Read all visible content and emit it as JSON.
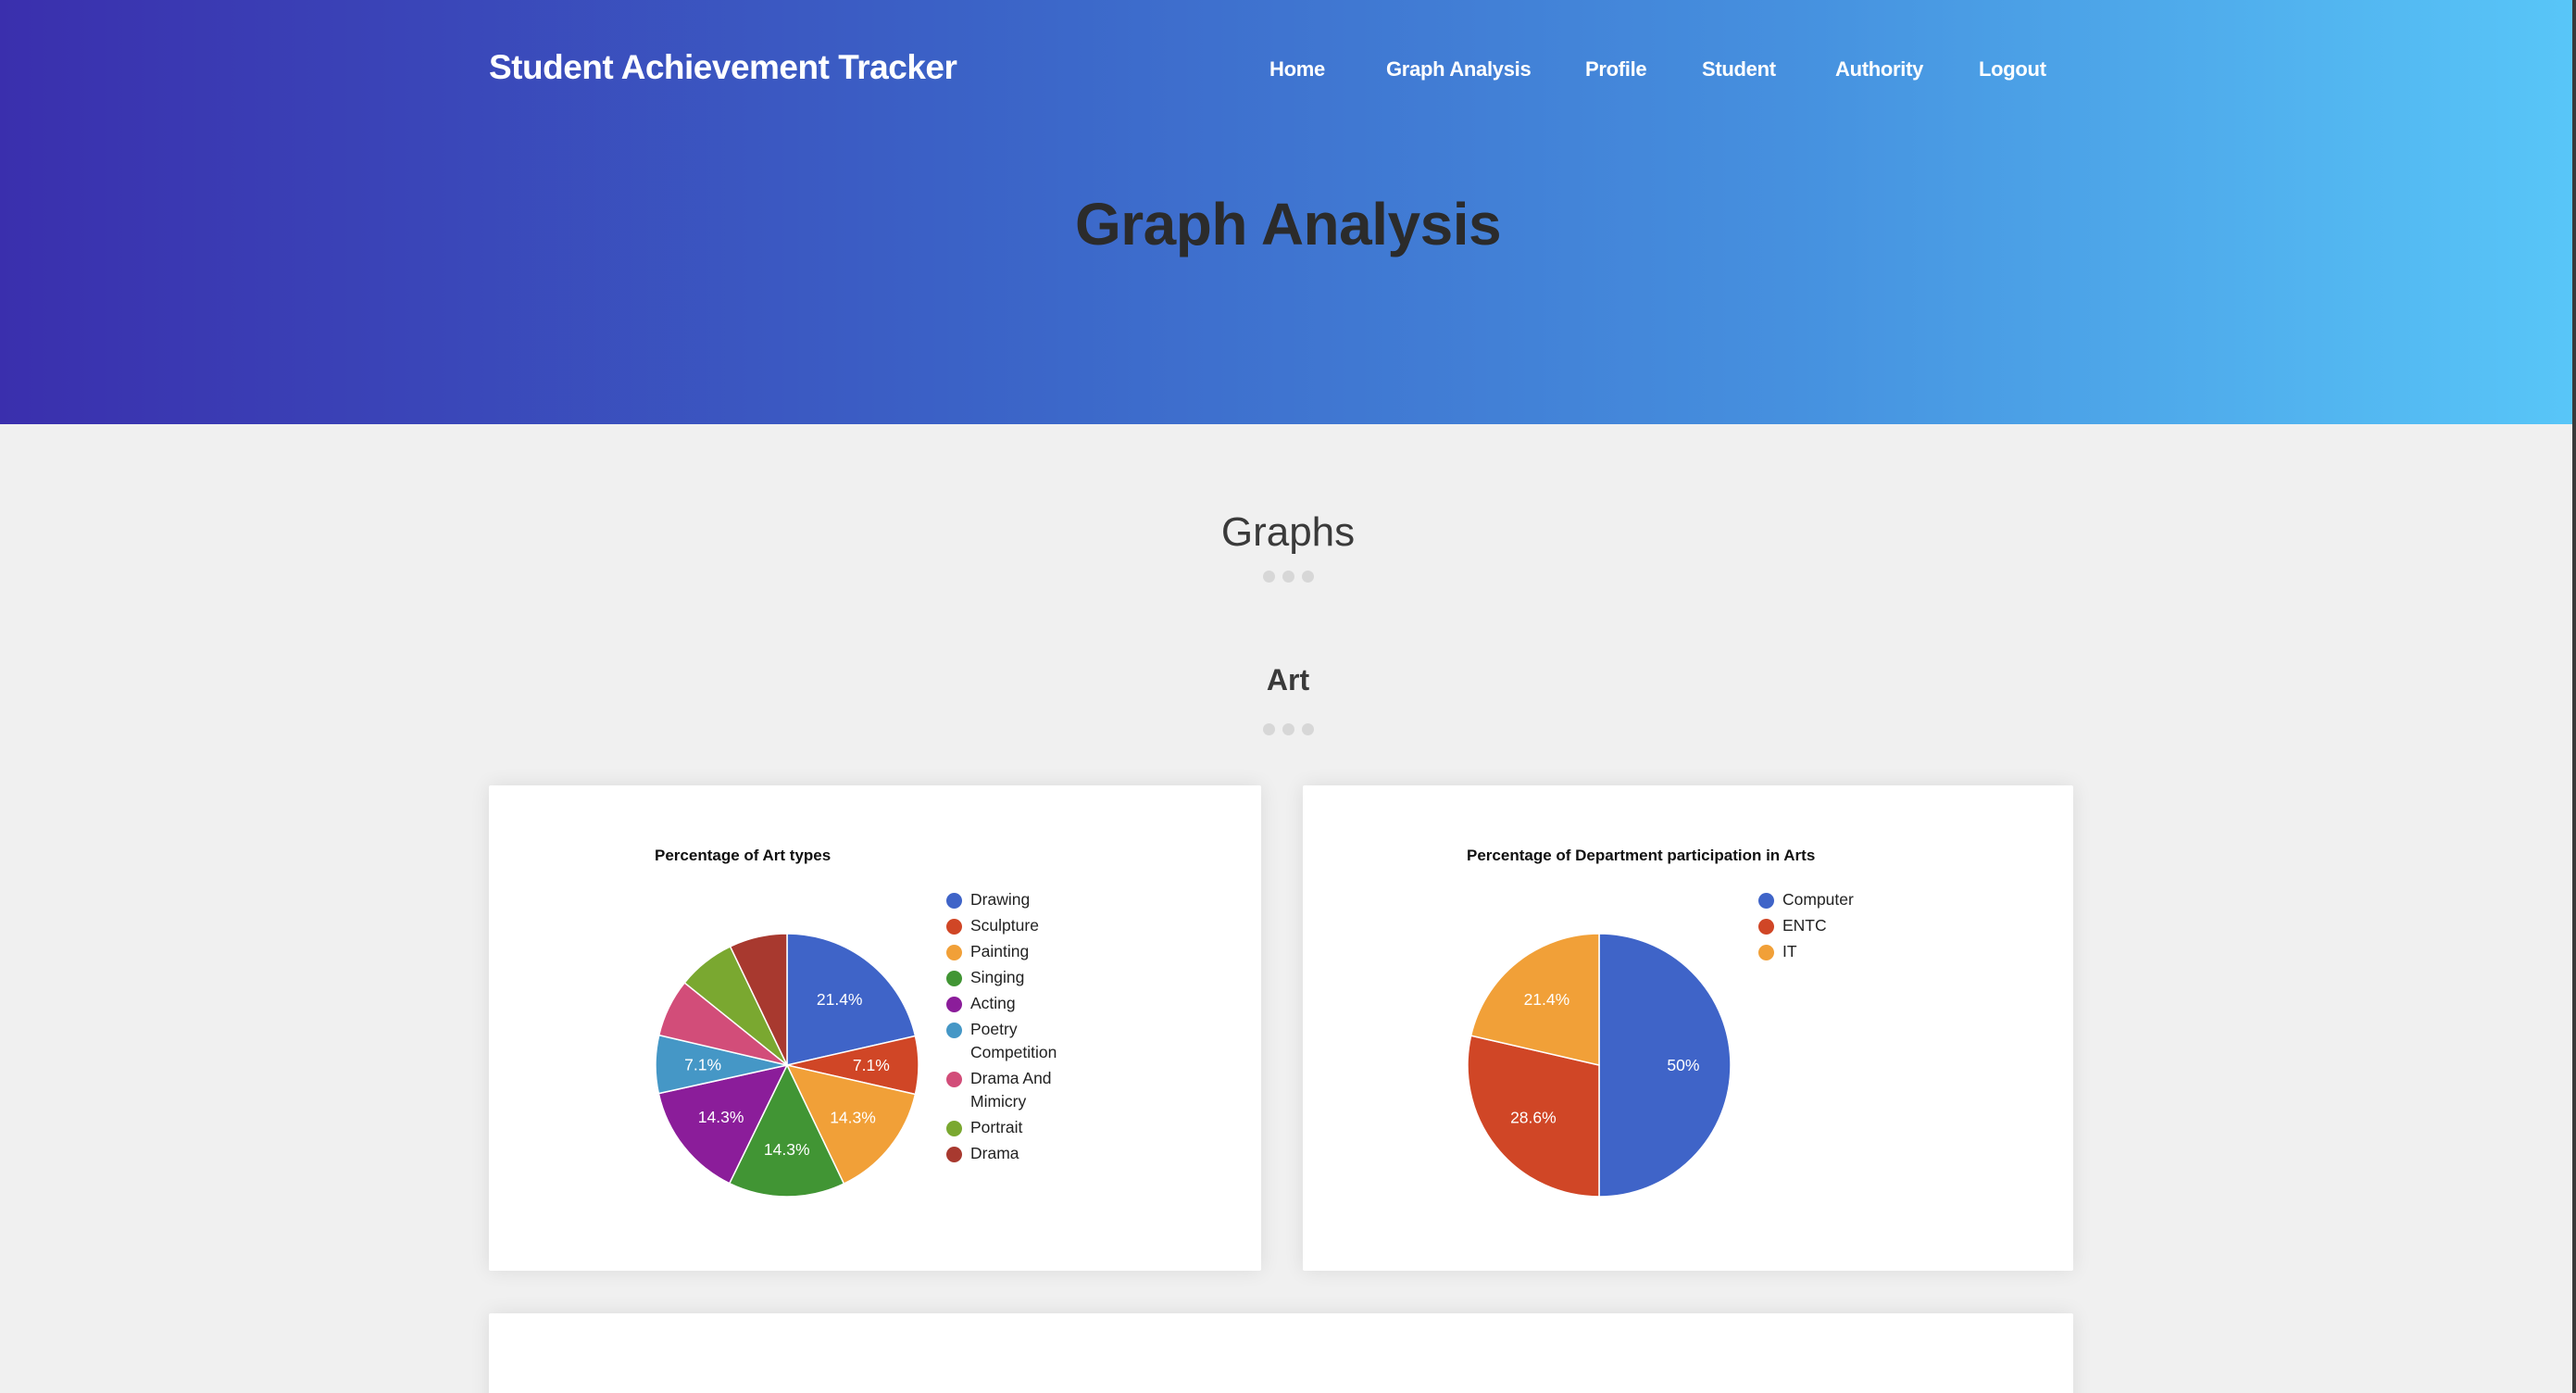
{
  "header": {
    "brand": "Student Achievement Tracker",
    "nav": [
      {
        "label": "Home"
      },
      {
        "label": "Graph Analysis"
      },
      {
        "label": "Profile"
      },
      {
        "label": "Student"
      },
      {
        "label": "Authority"
      },
      {
        "label": "Logout"
      }
    ],
    "page_title": "Graph Analysis"
  },
  "main": {
    "section_title": "Graphs",
    "subsection_title": "Art"
  },
  "chart_data": [
    {
      "type": "pie",
      "title": "Percentage of Art types",
      "categories": [
        "Drawing",
        "Sculpture",
        "Painting",
        "Singing",
        "Acting",
        "Poetry Competition",
        "Drama And Mimicry",
        "Portrait",
        "Drama"
      ],
      "values": [
        21.4,
        7.1,
        14.3,
        14.3,
        14.3,
        7.1,
        7.1,
        7.1,
        7.1
      ],
      "data_labels": [
        "21.4%",
        "7.1%",
        "14.3%",
        "14.3%",
        "14.3%",
        "7.1%",
        "",
        "",
        ""
      ],
      "colors": [
        "#3f64c8",
        "#d04626",
        "#f1a038",
        "#419534",
        "#8b1d9a",
        "#4597c6",
        "#d24d79",
        "#7aa830",
        "#a8392f"
      ],
      "legend": "right"
    },
    {
      "type": "pie",
      "title": "Percentage of Department participation in Arts",
      "categories": [
        "Computer",
        "ENTC",
        "IT"
      ],
      "values": [
        50,
        28.6,
        21.4
      ],
      "data_labels": [
        "50%",
        "28.6%",
        "21.4%"
      ],
      "colors": [
        "#3f64c8",
        "#d04626",
        "#f1a038"
      ],
      "legend": "right"
    }
  ]
}
